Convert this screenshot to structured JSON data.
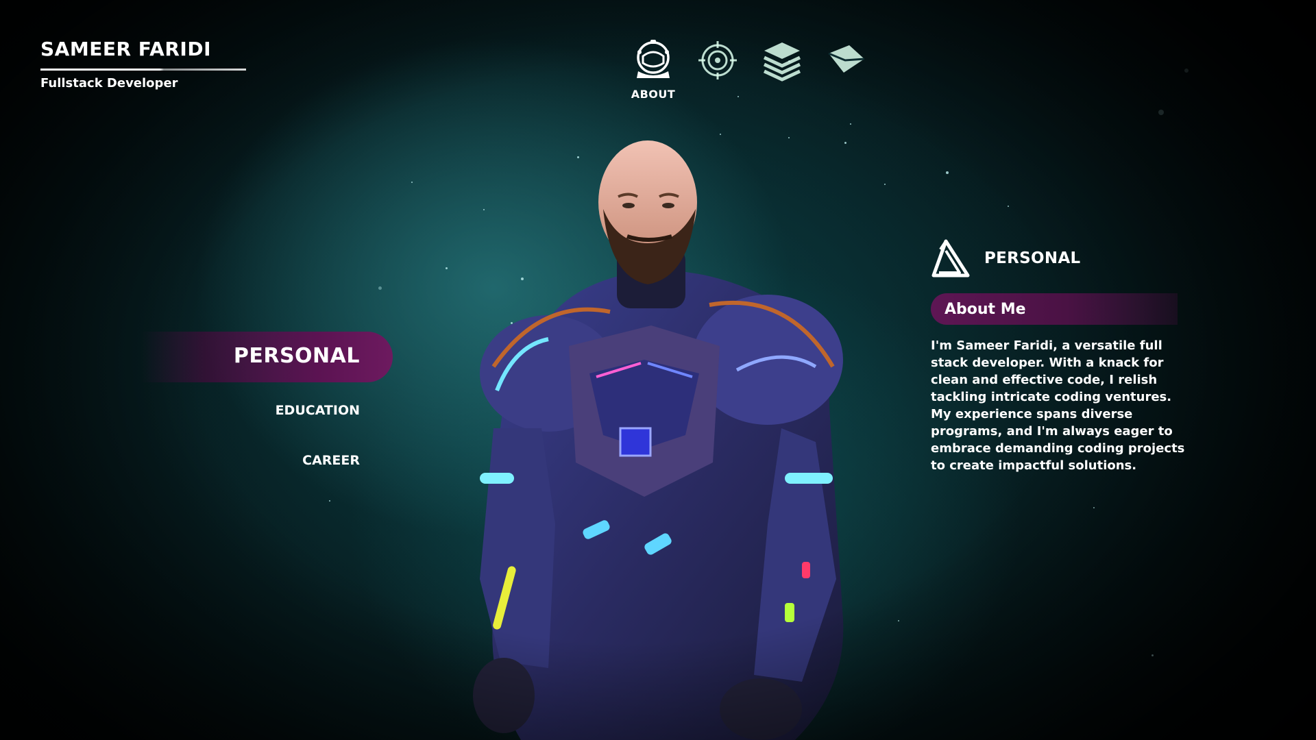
{
  "brand": {
    "name": "SAMEER FARIDI",
    "subtitle": "Fullstack Developer"
  },
  "topnav": {
    "items": [
      {
        "icon": "astronaut-helmet-icon",
        "label": "ABOUT",
        "active": true
      },
      {
        "icon": "target-crosshair-icon",
        "label": "",
        "active": false
      },
      {
        "icon": "layers-stack-icon",
        "label": "",
        "active": false
      },
      {
        "icon": "envelope-icon",
        "label": "",
        "active": false
      }
    ]
  },
  "sections": {
    "active": "PERSONAL",
    "items": [
      "EDUCATION",
      "CAREER"
    ]
  },
  "panel": {
    "icon": "penrose-triangle-icon",
    "title": "PERSONAL",
    "banner": "About Me",
    "body": "I'm Sameer Faridi, a versatile full stack developer. With a knack for clean and effective code, I relish tackling intricate coding ventures. My experience spans diverse programs, and I'm always eager to embrace demanding coding projects to create impactful solutions."
  },
  "colors": {
    "accent_purple": "#5b1352",
    "background_teal": "#0c3236",
    "text": "#ffffff"
  }
}
